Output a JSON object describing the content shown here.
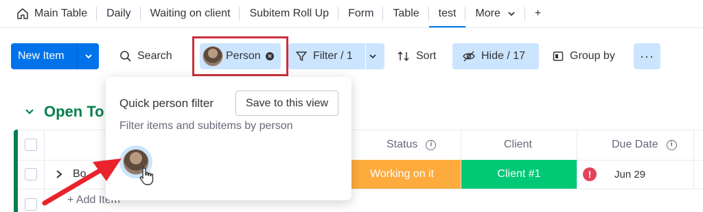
{
  "tabs": [
    {
      "label": "Main Table",
      "icon": "home-icon"
    },
    {
      "label": "Daily"
    },
    {
      "label": "Waiting on client"
    },
    {
      "label": "Subitem Roll Up"
    },
    {
      "label": "Form"
    },
    {
      "label": "Table"
    },
    {
      "label": "test",
      "active": true
    },
    {
      "label": "More"
    },
    {
      "label": "+"
    }
  ],
  "toolbar": {
    "new_item": "New Item",
    "search": "Search",
    "person": "Person",
    "filter": "Filter / 1",
    "sort": "Sort",
    "hide": "Hide / 17",
    "group_by": "Group by",
    "more": "···"
  },
  "group": {
    "title": "Open To",
    "color": "#037f4c"
  },
  "table": {
    "columns": {
      "status": "Status",
      "client": "Client",
      "due_date": "Due Date"
    },
    "row": {
      "name": "Bo",
      "status": "Working on it",
      "client": "Client #1",
      "due_date": "Jun 29",
      "alert": "!"
    },
    "add_item": "+ Add Item"
  },
  "popover": {
    "title": "Quick person filter",
    "save_button": "Save to this view",
    "subtitle": "Filter items and subitems by person"
  },
  "colors": {
    "primary": "#0073ea",
    "selected_bg": "#cce5ff",
    "highlight_box": "#c9303b",
    "status_working": "#fdab3d",
    "client_green": "#00c875",
    "alert_red": "#e2445c",
    "arrow_red": "#e8232b"
  }
}
